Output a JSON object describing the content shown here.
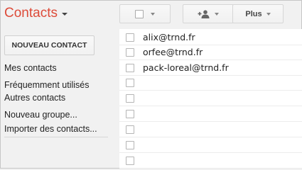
{
  "header": {
    "title": "Contacts",
    "more_label": "Plus"
  },
  "sidebar": {
    "new_contact_label": "NOUVEAU CONTACT",
    "items": [
      {
        "label": "Mes contacts"
      },
      {
        "label": "Fréquemment utilisés"
      },
      {
        "label": "Autres contacts"
      },
      {
        "label": "Nouveau groupe..."
      },
      {
        "label": "Importer des contacts..."
      }
    ]
  },
  "contacts": [
    {
      "email": "alix@trnd.fr"
    },
    {
      "email": "orfee@trnd.fr"
    },
    {
      "email": "pack-loreal@trnd.fr"
    },
    {
      "email": ""
    },
    {
      "email": ""
    },
    {
      "email": ""
    },
    {
      "email": ""
    },
    {
      "email": ""
    },
    {
      "email": ""
    }
  ],
  "icons": {
    "add_contact": "add-person-icon",
    "dropdown": "chevron-down-icon"
  },
  "colors": {
    "title": "#dd4b39",
    "background": "#f1f1f1",
    "list_background": "#ffffff"
  }
}
